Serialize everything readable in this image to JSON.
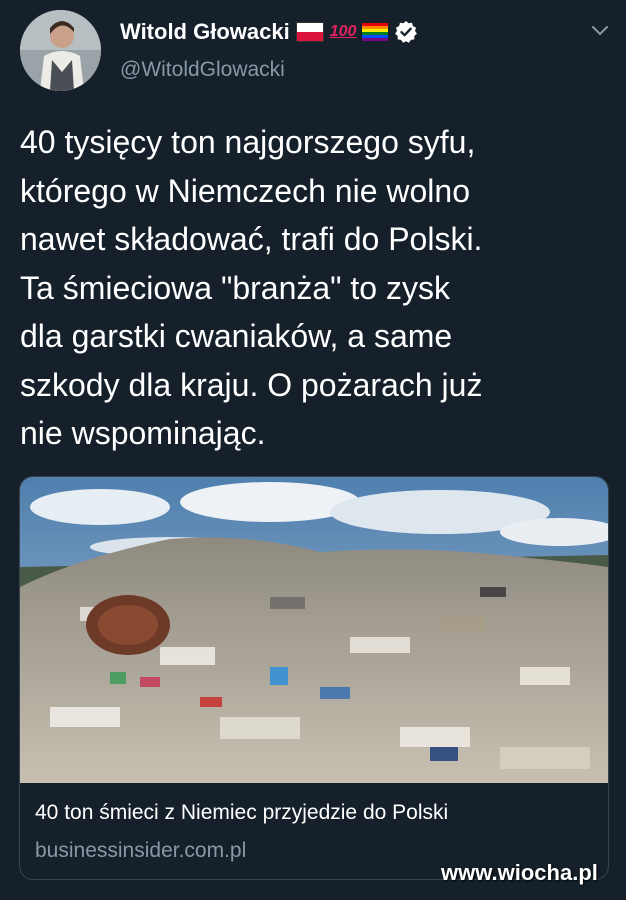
{
  "tweet": {
    "author": {
      "display_name": "Witold Głowacki",
      "handle": "@WitoldGlowacki",
      "badges": [
        "poland-flag",
        "hundred-points",
        "rainbow-flag",
        "verified-badge"
      ]
    },
    "text": "40 tysięcy ton najgorszego syfu,\nktórego w Niemczech nie wolno\nnawet składować, trafi do Polski.\nTa śmieciowa \"branża\" to zysk\ndla garstki cwaniaków, a same\nszkody dla kraju. O pożarach już\nnie wspominając.",
    "link_card": {
      "image": "landfill-garbage-photo",
      "title": "40 ton śmieci z Niemiec przyjedzie do Polski",
      "domain": "businessinsider.com.pl"
    }
  },
  "watermark": "www.wiocha.pl",
  "colors": {
    "background": "#15202b",
    "secondary_text": "#8899a6",
    "card_border": "#38444d",
    "verified": "#ffffff"
  }
}
